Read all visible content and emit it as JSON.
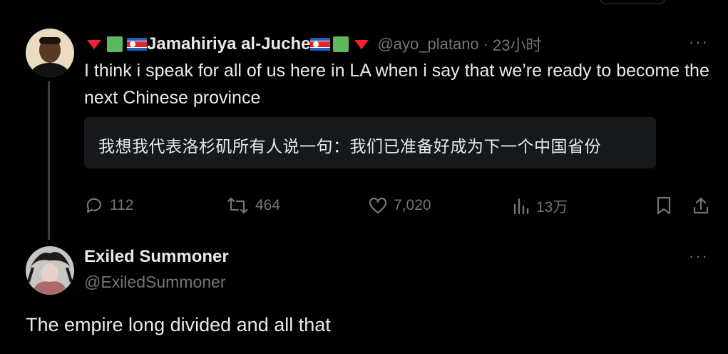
{
  "tweet": {
    "name_prefix_decor": "▼",
    "display_name": "Jamahiriya al-Juche",
    "handle": "@ayo_platano",
    "separator": "·",
    "time": "23小时",
    "more": "···",
    "text": "I think i speak for all of us here in LA when i say that we’re ready to become the next Chinese province",
    "translation": "我想我代表洛杉矶所有人说一句：我们已准备好成为下一个中国省份",
    "replies": "112",
    "reposts": "464",
    "likes": "7,020",
    "views": "13万",
    "colors": {
      "flag_red": "#e0262b",
      "flag_blue": "#1f5fbf",
      "green": "#5cb85c",
      "triangle": "#f4212e"
    }
  },
  "reply": {
    "display_name": "Exiled Summoner",
    "handle": "@ExiledSummoner",
    "more": "···",
    "text": "The empire long divided and all that"
  }
}
